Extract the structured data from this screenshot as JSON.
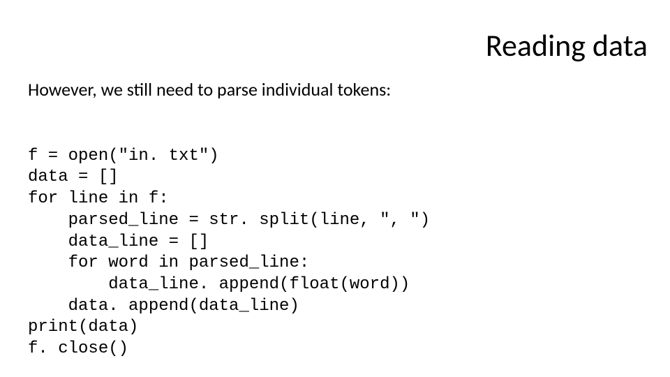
{
  "title": "Reading data",
  "subtitle": "However, we still need to parse individual tokens:",
  "code": {
    "l1": "f = open(\"in. txt\")",
    "l2": "data = []",
    "l3": "for line in f:",
    "l4": "    parsed_line = str. split(line, \", \")",
    "l5": "    data_line = []",
    "l6": "    for word in parsed_line:",
    "l7": "        data_line. append(float(word))",
    "l8": "    data. append(data_line)",
    "l9": "print(data)",
    "l10": "f. close()"
  }
}
